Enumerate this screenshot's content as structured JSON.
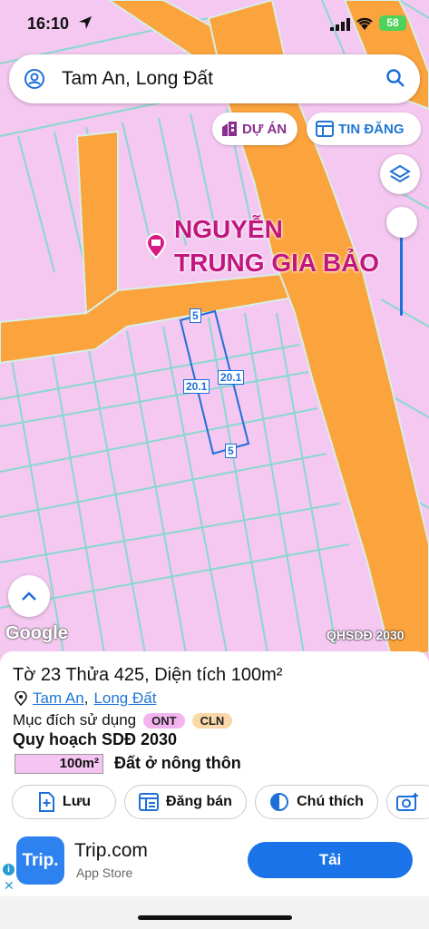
{
  "status_bar": {
    "time": "16:10",
    "battery": "58"
  },
  "search": {
    "query": "Tam An, Long Đất"
  },
  "chips": {
    "project": "DỰ ÁN",
    "listings": "TIN ĐĂNG"
  },
  "map": {
    "poi_line1": "NGUYỄN",
    "poi_line2": "TRUNG GIA BẢO",
    "dim_top": "5",
    "dim_left": "20.1",
    "dim_right": "20.1",
    "dim_bottom": "5",
    "google": "Google",
    "layer_label": "QHSDĐ 2030"
  },
  "parcel": {
    "title": "Tờ 23 Thửa 425, Diện tích 100m²",
    "ward": "Tam An",
    "district": "Long Đất",
    "purpose_label": "Mục đích sử dụng",
    "tag1": "ONT",
    "tag2": "CLN",
    "plan_title": "Quy hoạch SDĐ 2030",
    "area_value": "100m²",
    "area_desc": "Đất ở nông thôn"
  },
  "actions": {
    "save": "Lưu",
    "sell": "Đăng bán",
    "legend": "Chú thích"
  },
  "ad": {
    "logo_text": "Trip.",
    "name": "Trip.com",
    "store": "App Store",
    "cta": "Tải"
  },
  "colors": {
    "road": "#fba33c",
    "land": "#f4c8f0",
    "grid": "#88d8d0",
    "parcel": "#1f6fd9",
    "accent_blue": "#1a73e8"
  }
}
